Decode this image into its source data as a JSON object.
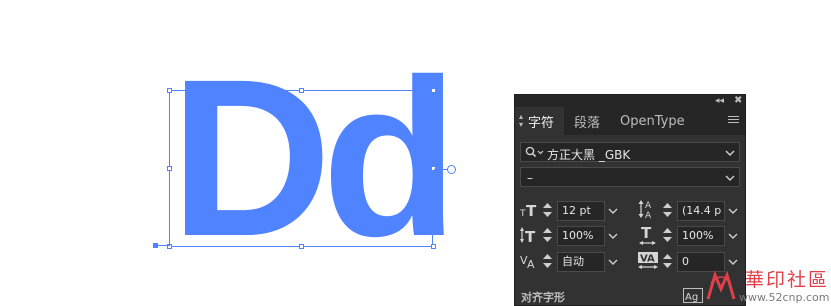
{
  "artwork": {
    "text": "Dd",
    "color": "#4f83ff"
  },
  "panel": {
    "tabs": [
      {
        "label": "字符",
        "active": true
      },
      {
        "label": "段落",
        "active": false
      },
      {
        "label": "OpenType",
        "active": false
      }
    ],
    "font_family": "方正大黑 _GBK",
    "font_style": "–",
    "font_size": "12 pt",
    "leading": "(14.4 p",
    "vertical_scale": "100%",
    "horizontal_scale": "100%",
    "kerning": "自动",
    "tracking": "0",
    "footer_label": "对齐字形",
    "colors": {
      "panel_bg": "#323232",
      "field_bg": "#262626",
      "text": "#d6d6d6"
    }
  },
  "watermark": {
    "title": "華印社區",
    "url": "www.52cnp.com"
  }
}
